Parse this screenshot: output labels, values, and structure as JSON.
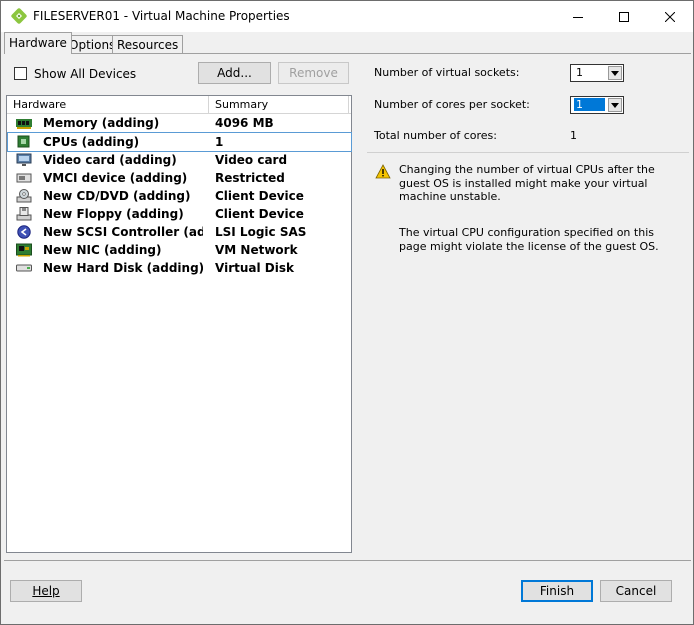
{
  "window": {
    "title": "FILESERVER01 - Virtual Machine Properties"
  },
  "tabs": [
    {
      "label": "Hardware",
      "active": true
    },
    {
      "label": "Options",
      "active": false
    },
    {
      "label": "Resources",
      "active": false
    }
  ],
  "left": {
    "show_all_label": "Show All Devices",
    "show_all_checked": false,
    "add_label": "Add...",
    "remove_label": "Remove",
    "columns": [
      "Hardware",
      "Summary"
    ],
    "devices": [
      {
        "name": "Memory (adding)",
        "summary": "4096 MB",
        "icon": "memory-icon",
        "selected": false
      },
      {
        "name": "CPUs (adding)",
        "summary": "1",
        "icon": "cpu-icon",
        "selected": true
      },
      {
        "name": "Video card  (adding)",
        "summary": "Video card",
        "icon": "video-card-icon",
        "selected": false
      },
      {
        "name": "VMCI device (adding)",
        "summary": "Restricted",
        "icon": "vmci-icon",
        "selected": false
      },
      {
        "name": "New CD/DVD (adding)",
        "summary": "Client Device",
        "icon": "cd-dvd-icon",
        "selected": false
      },
      {
        "name": "New Floppy (adding)",
        "summary": "Client Device",
        "icon": "floppy-icon",
        "selected": false
      },
      {
        "name": "New SCSI Controller (adding)",
        "summary": "LSI Logic SAS",
        "icon": "scsi-controller-icon",
        "selected": false
      },
      {
        "name": "New NIC (adding)",
        "summary": "VM Network",
        "icon": "nic-icon",
        "selected": false
      },
      {
        "name": "New Hard Disk (adding)",
        "summary": "Virtual Disk",
        "icon": "hard-disk-icon",
        "selected": false
      }
    ]
  },
  "right": {
    "sockets_label": "Number of virtual sockets:",
    "sockets_value": "1",
    "cores_label": "Number of cores per socket:",
    "cores_value": "1",
    "total_label": "Total number of cores:",
    "total_value": "1",
    "warning_text": "Changing the number of virtual CPUs after the guest OS is installed might make your virtual machine unstable.",
    "info_text": "The virtual CPU configuration specified on this page might violate the license of the guest OS."
  },
  "footer": {
    "help_label": "Help",
    "finish_label": "Finish",
    "cancel_label": "Cancel"
  },
  "colors": {
    "accent": "#0078d7",
    "window_bg": "#f0f0f0",
    "warning": "#f5c400",
    "title_icon": "#8cc63f"
  }
}
